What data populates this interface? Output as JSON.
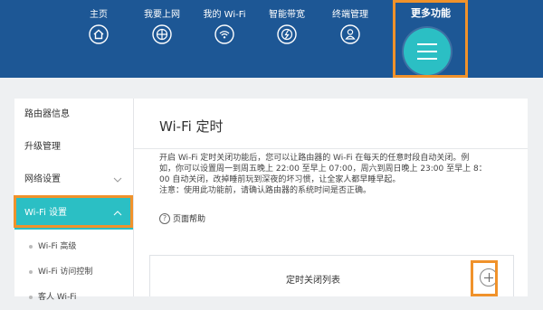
{
  "nav": {
    "home": "主页",
    "internet": "我要上网",
    "wifi": "我的 Wi-Fi",
    "bandwidth": "智能带宽",
    "terminal": "终端管理",
    "more": "更多功能"
  },
  "sidebar": {
    "items": [
      {
        "label": "路由器信息"
      },
      {
        "label": "升级管理"
      },
      {
        "label": "网络设置"
      },
      {
        "label": "Wi-Fi 设置"
      }
    ],
    "sub_items": [
      {
        "label": "Wi-Fi 高级"
      },
      {
        "label": "Wi-Fi 访问控制"
      },
      {
        "label": "客人 Wi-Fi"
      }
    ]
  },
  "main": {
    "title": "Wi-Fi 定时",
    "desc_line1": "开启 Wi-Fi 定时关闭功能后，您可以让路由器的 Wi-Fi 在每天的任意时段自动关闭。例",
    "desc_line2": "如，你可以设置周一到周五晚上 22:00 至早上 07:00，周六到周日晚上 23:00 至早上 8：",
    "desc_line3": "00 自动关闭，改掉睡前玩到深夜的坏习惯，让全家人都早睡早起。",
    "desc_line4": "注意：使用此功能前，请确认路由器的系统时间是否正确。",
    "help": "页面帮助",
    "list_title": "定时关闭列表"
  },
  "colors": {
    "nav_bg": "#1d5795",
    "accent": "#2bbfc4",
    "highlight": "#f0922b"
  }
}
